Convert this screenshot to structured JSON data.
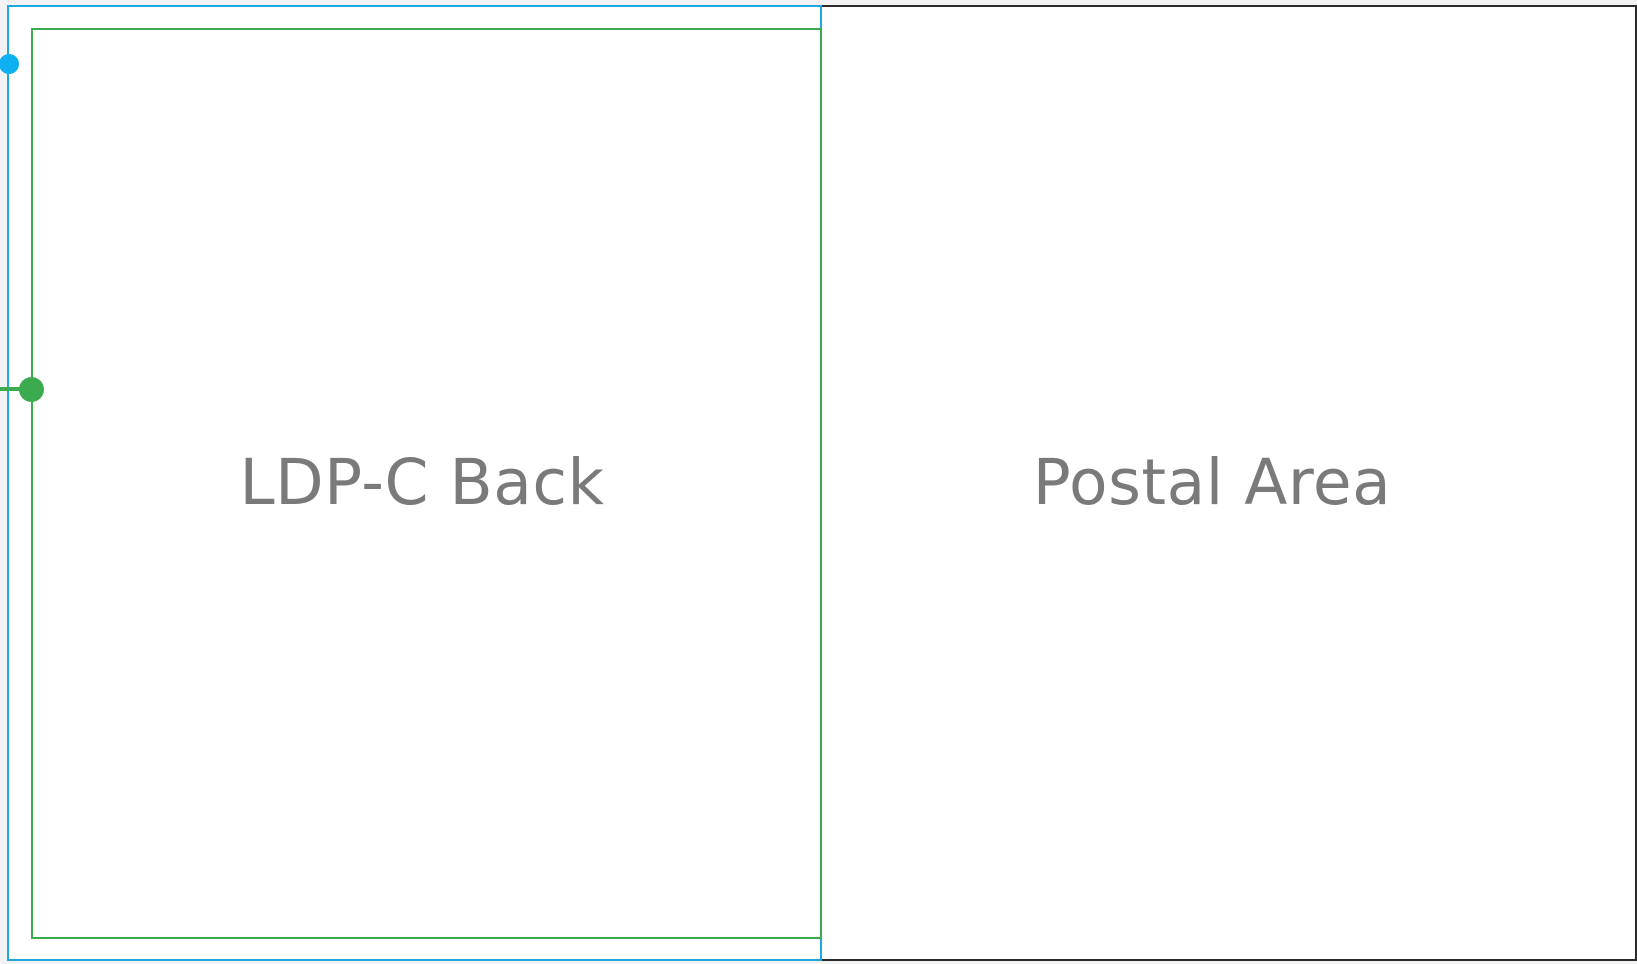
{
  "layout_editor": {
    "panels": {
      "back_label": "LDP-C Back",
      "postal_label": "Postal Area"
    },
    "colors": {
      "outer_border": "#2b2b2b",
      "selection_border": "#1ea8e3",
      "safe_area_border": "#3cab4f",
      "blue_handle": "#0db0f0",
      "green_handle": "#3cab4f",
      "label_text": "#7a7a7a"
    }
  }
}
